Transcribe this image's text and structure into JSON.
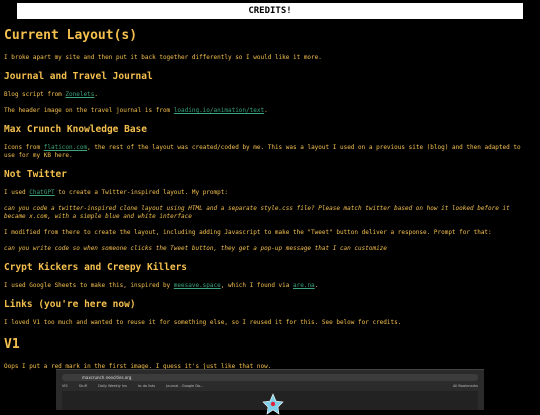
{
  "banner": {
    "label": "CREDITS!"
  },
  "page_title": "Current Layout(s)",
  "intro": "I broke apart my site and then put it back together differently so I would like it more.",
  "journal": {
    "heading": "Journal and Travel Journal",
    "p1_before": "Blog script from ",
    "p1_link": "Zonelets",
    "p1_after": ".",
    "p2_before": "The header image on the travel journal is from ",
    "p2_link": "loading.io/animation/text",
    "p2_after": "."
  },
  "knowledge": {
    "heading": "Max Crunch Knowledge Base",
    "p1_before": "Icons from ",
    "p1_link": "flaticon.com",
    "p1_after": ", the rest of the layout was created/coded by me. This was a layout I used on a previous site (blog) and then adapted to use for my KB here."
  },
  "twitter": {
    "heading": "Not Twitter",
    "p1_before": "I used ",
    "p1_link": "ChatGPT",
    "p1_after": " to create a Twitter-inspired layout. My prompt:",
    "prompt1": "can you code a twitter-inspired clone layout using HTML and a separate style.css file? Please match twitter based on how it looked before it became x.com, with a simple blue and white interface",
    "p2": "I modified from there to create the layout, including adding Javascript to make the \"Tweet\" button deliver a response. Prompt for that:",
    "prompt2": "can you write code so when someone clicks the Tweet button, they get a pop-up message that I can customize"
  },
  "crypt": {
    "heading": "Crypt Kickers and Creepy Killers",
    "p1_before": "I used Google Sheets to make this, inspired by ",
    "p1_link": "meesave.space",
    "p1_mid": ", which I found via ",
    "p1_link2": "are.na",
    "p1_after": "."
  },
  "links": {
    "heading": "Links (you're here now)",
    "p1": "I loved V1 too much and wanted to reuse it for something else, so I reused it for this. See below for credits."
  },
  "v1": {
    "heading": "V1",
    "p1": "Oops I put a red mark in the first image. I guess it's just like that now."
  },
  "screenshot": {
    "url": "maxcrunch.neocities.org",
    "bookmarks": [
      "VIS",
      "Stuff",
      "Daily Weekly Ins",
      "to do lists",
      "Journal - Google Do...",
      "All Bookmarks"
    ]
  }
}
